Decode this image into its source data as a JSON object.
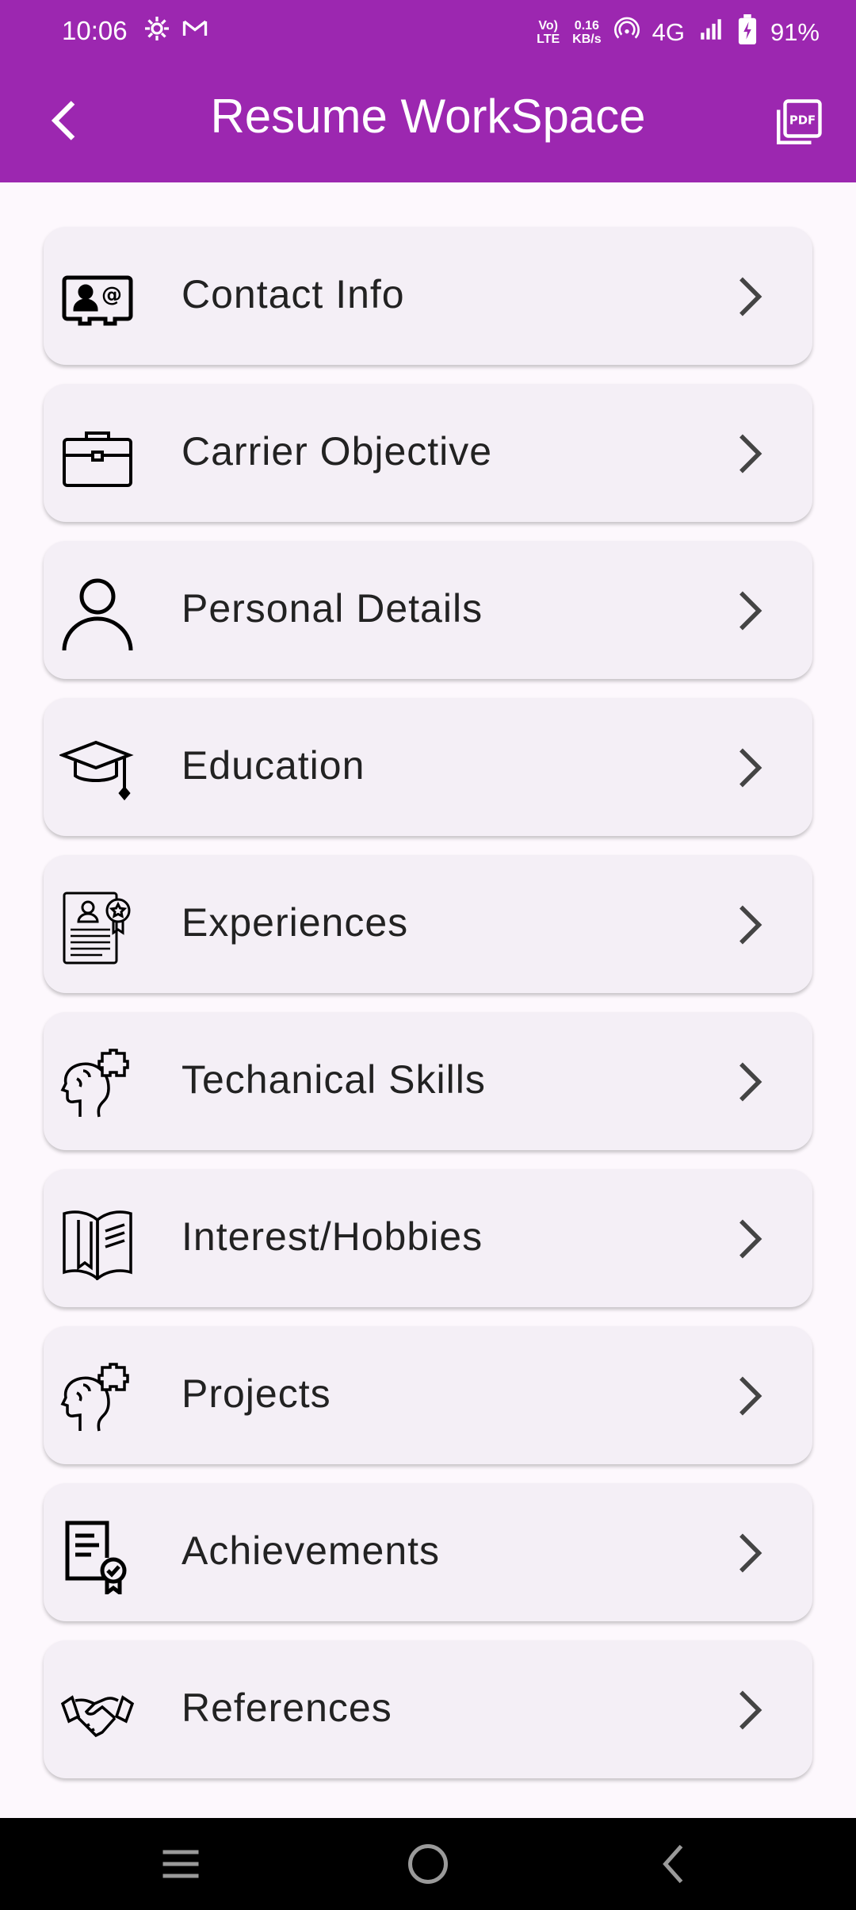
{
  "status_bar": {
    "time": "10:06",
    "volte_top": "Vo)",
    "volte_bottom": "LTE",
    "speed_value": "0.16",
    "speed_unit": "KB/s",
    "network": "4G",
    "battery": "91%"
  },
  "app_bar": {
    "title": "Resume WorkSpace",
    "background_color": "#9c27b0",
    "back_icon": "back-arrow-icon",
    "action_icon": "pdf-files-icon"
  },
  "sections": [
    {
      "label": "Contact Info",
      "icon": "contact-card-icon"
    },
    {
      "label": "Carrier Objective",
      "icon": "briefcase-icon"
    },
    {
      "label": "Personal Details",
      "icon": "person-icon"
    },
    {
      "label": "Education",
      "icon": "graduation-cap-icon"
    },
    {
      "label": "Experiences",
      "icon": "certificate-icon"
    },
    {
      "label": "Techanical Skills",
      "icon": "head-puzzle-icon"
    },
    {
      "label": "Interest/Hobbies",
      "icon": "open-book-icon"
    },
    {
      "label": "Projects",
      "icon": "head-puzzle-icon"
    },
    {
      "label": "Achievements",
      "icon": "document-badge-icon"
    },
    {
      "label": "References",
      "icon": "handshake-icon"
    }
  ],
  "nav_bar": {
    "menu_icon": "menu-icon",
    "home_icon": "home-circle-icon",
    "back_icon": "back-triangle-icon"
  }
}
